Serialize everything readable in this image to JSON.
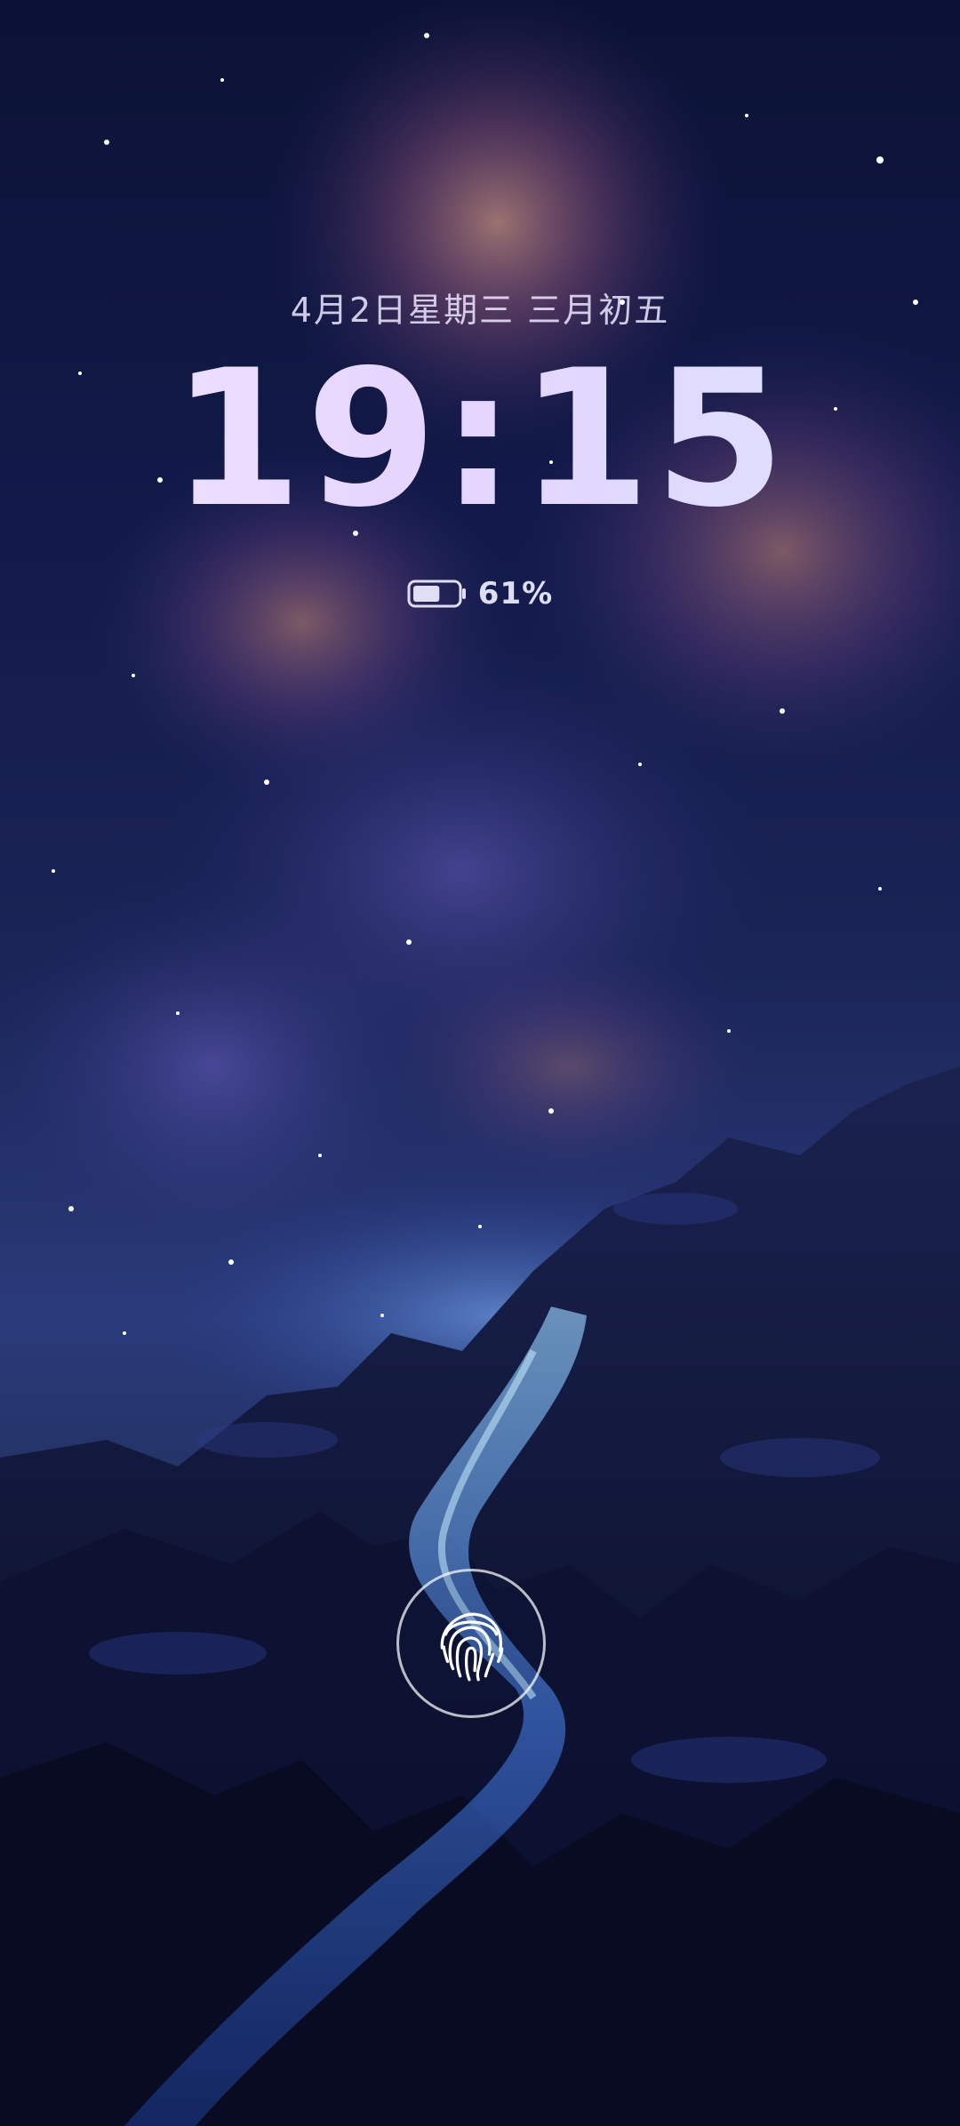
{
  "lockscreen": {
    "date": "4月2日星期三 三月初五",
    "time": "19:15",
    "battery_percent": 0.61,
    "battery_text": "61%"
  },
  "icons": {
    "battery": "battery-icon",
    "fingerprint": "fingerprint-icon"
  },
  "colors": {
    "text": "#e9e6ff",
    "clock_gradient_start": "#f1e6ff",
    "clock_gradient_end": "#dce2ff",
    "fingerprint_ring": "#ffffff"
  }
}
